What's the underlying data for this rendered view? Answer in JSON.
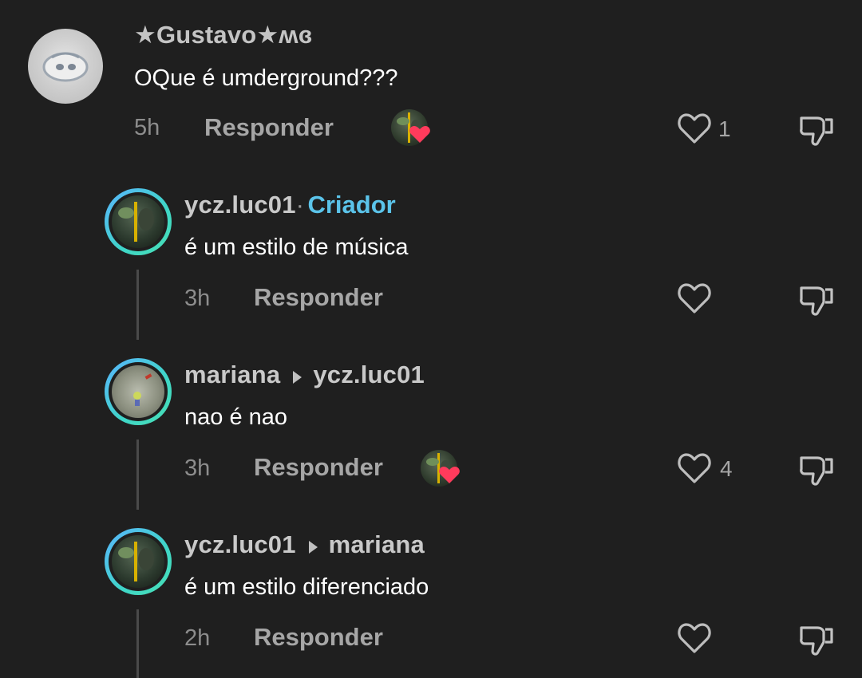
{
  "comments": [
    {
      "username": "★Gustavo★ʍɞ",
      "text": "OQue é umderground???",
      "time": "5h",
      "reply_label": "Responder",
      "likes": "1",
      "creator_liked": true
    },
    {
      "username": "ycz.luc01",
      "separator": "·",
      "badge": "Criador",
      "text": "é um estilo de música",
      "time": "3h",
      "reply_label": "Responder",
      "likes": "",
      "creator_liked": false
    },
    {
      "username": "mariana",
      "reply_to": "ycz.luc01",
      "text": "nao é nao",
      "time": "3h",
      "reply_label": "Responder",
      "likes": "4",
      "creator_liked": true
    },
    {
      "username": "ycz.luc01",
      "reply_to": "mariana",
      "text": "é um estilo diferenciado",
      "time": "2h",
      "reply_label": "Responder",
      "likes": "",
      "creator_liked": false
    }
  ],
  "colors": {
    "background": "#1f1f1f",
    "creator_badge": "#5bc4ea",
    "heart_badge": "#ff3b5c"
  },
  "icons": [
    "heart-outline-icon",
    "dislike-icon",
    "heart-badge-icon",
    "reply-arrow-icon"
  ]
}
